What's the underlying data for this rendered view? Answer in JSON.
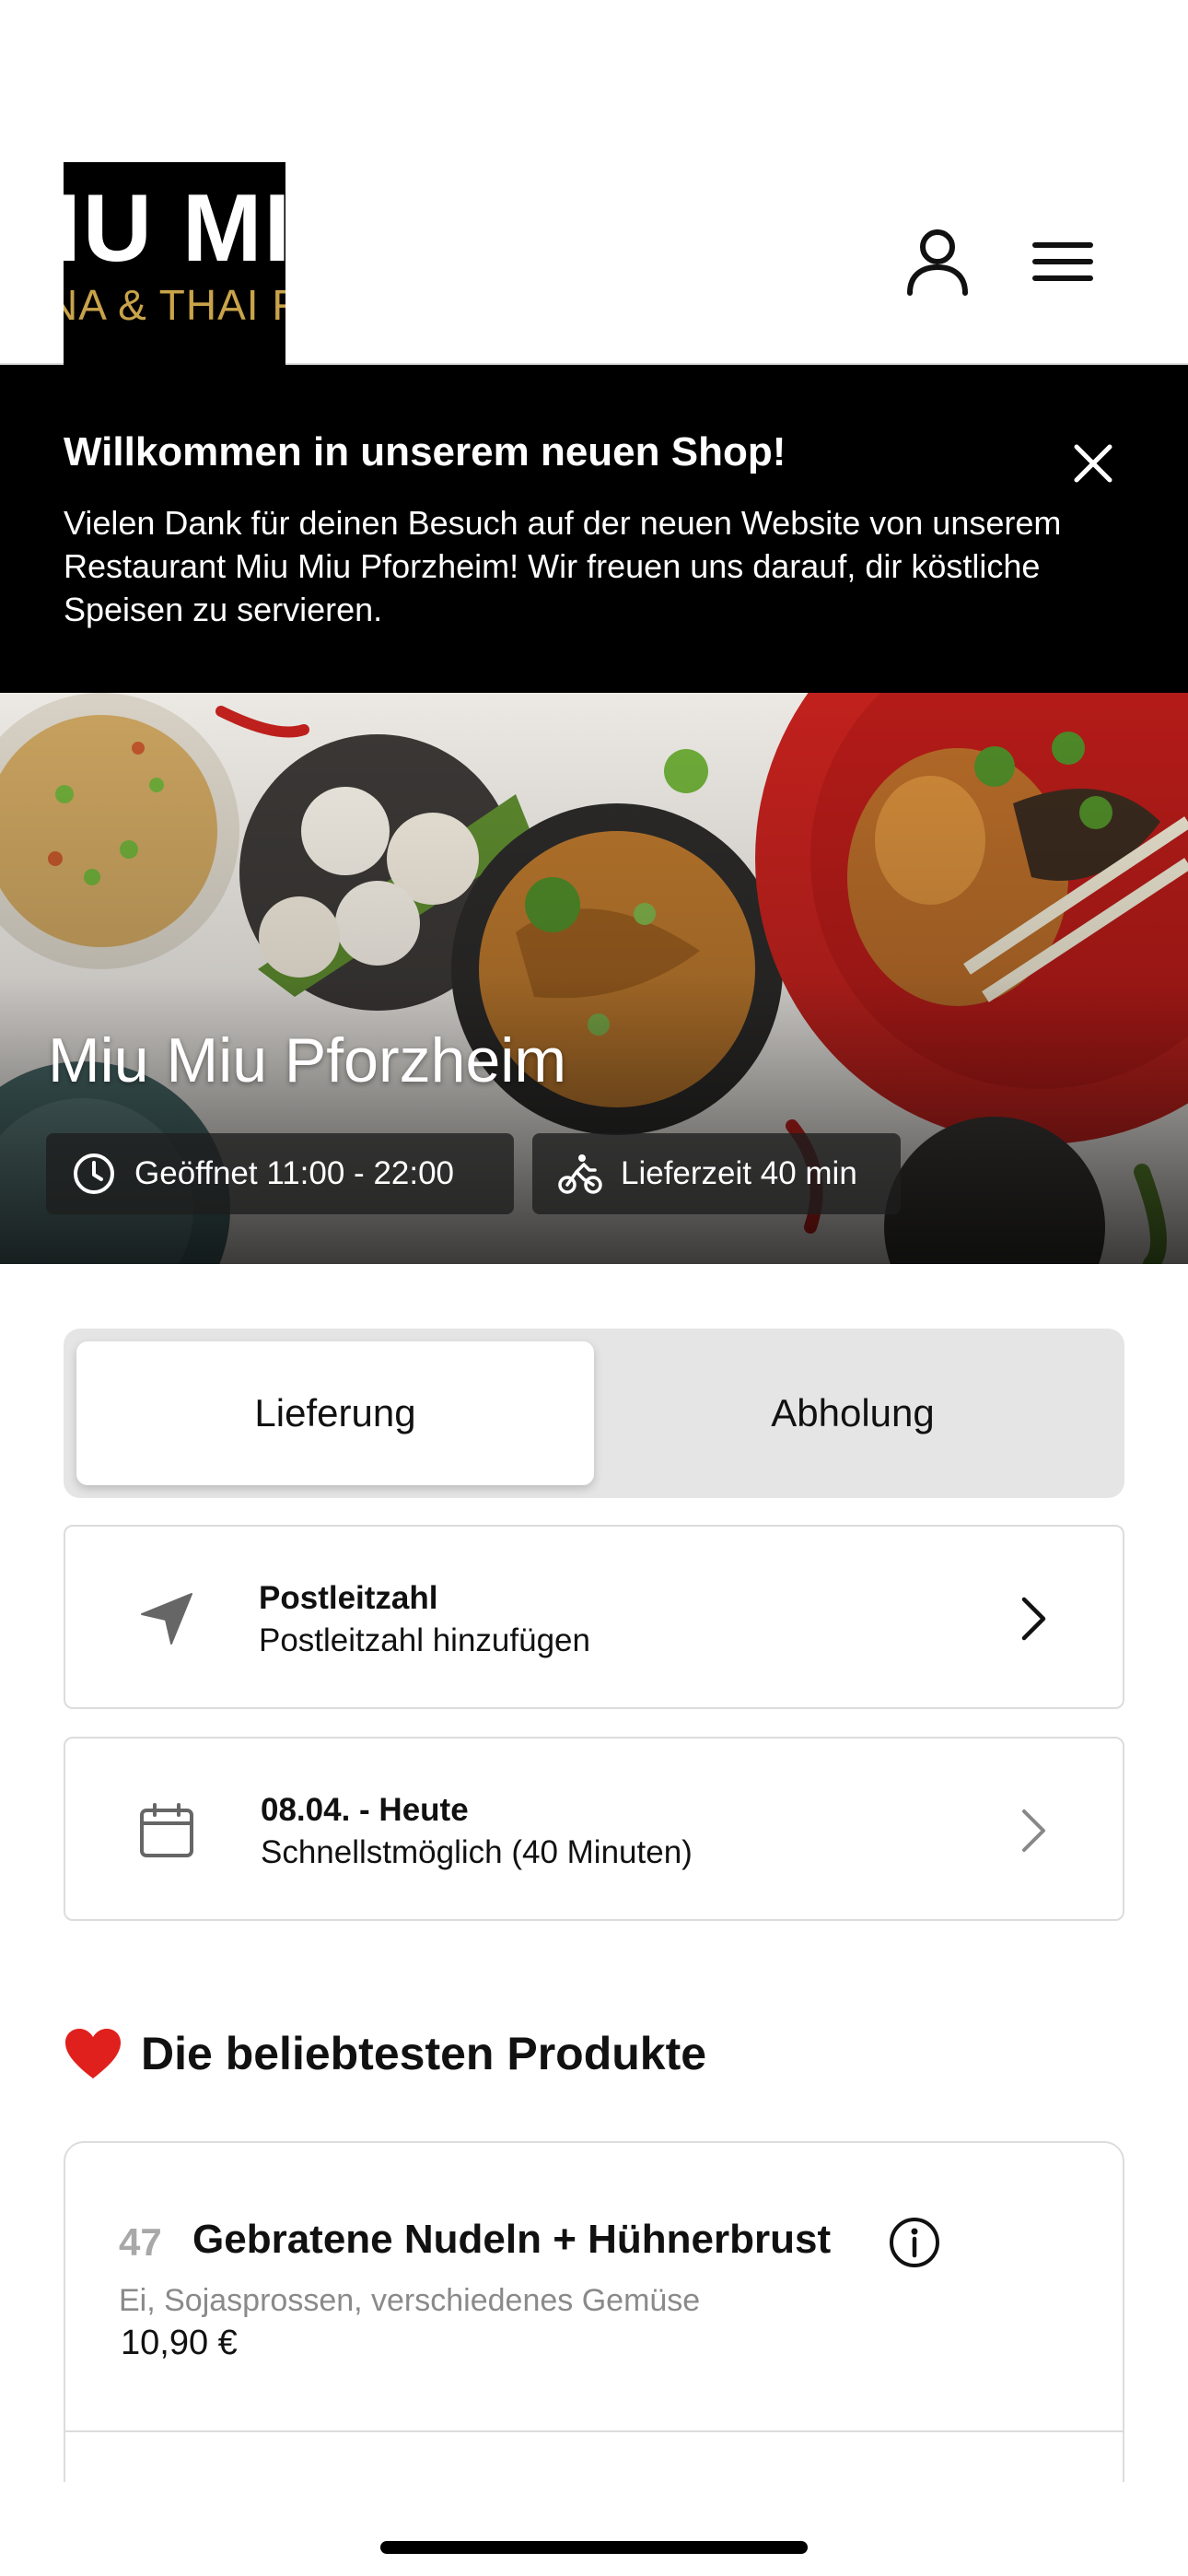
{
  "logo": {
    "line1": "IU MI",
    "line2": "NA & THAI FO"
  },
  "header": {
    "user_icon": "user-icon",
    "menu_icon": "hamburger-menu-icon"
  },
  "banner": {
    "title": "Willkommen in unserem neuen Shop!",
    "text": "Vielen Dank für deinen Besuch auf der neuen Website von unserem Restaurant Miu Miu Pforzheim! Wir freuen uns darauf, dir köstliche Speisen zu servieren.",
    "close_icon": "close-icon"
  },
  "hero": {
    "title": "Miu Miu Pforzheim",
    "opening": "Geöffnet 11:00 - 22:00",
    "delivery_time": "Lieferzeit 40 min",
    "clock_icon": "clock-icon",
    "bike_icon": "delivery-bike-icon"
  },
  "order_mode": {
    "options": [
      "Lieferung",
      "Abholung"
    ],
    "selected": "Lieferung"
  },
  "zip": {
    "title": "Postleitzahl",
    "subtitle": "Postleitzahl hinzufügen",
    "icon": "location-arrow-icon"
  },
  "date": {
    "title": "08.04. - Heute",
    "subtitle": "Schnellstmöglich (40 Minuten)",
    "icon": "calendar-icon"
  },
  "popular": {
    "emoji": "❤️",
    "title": "Die beliebtesten Produkte",
    "products": [
      {
        "number": "47",
        "name": "Gebratene Nudeln + Hühnerbrust",
        "description": "Ei, Sojasprossen, verschiedenes Gemüse",
        "price": "10,90 €"
      }
    ]
  },
  "colors": {
    "banner_bg": "#000000",
    "toggle_bg": "#e5e5e5",
    "logo_gold": "#c9a34a",
    "border": "#dcdcdc"
  }
}
